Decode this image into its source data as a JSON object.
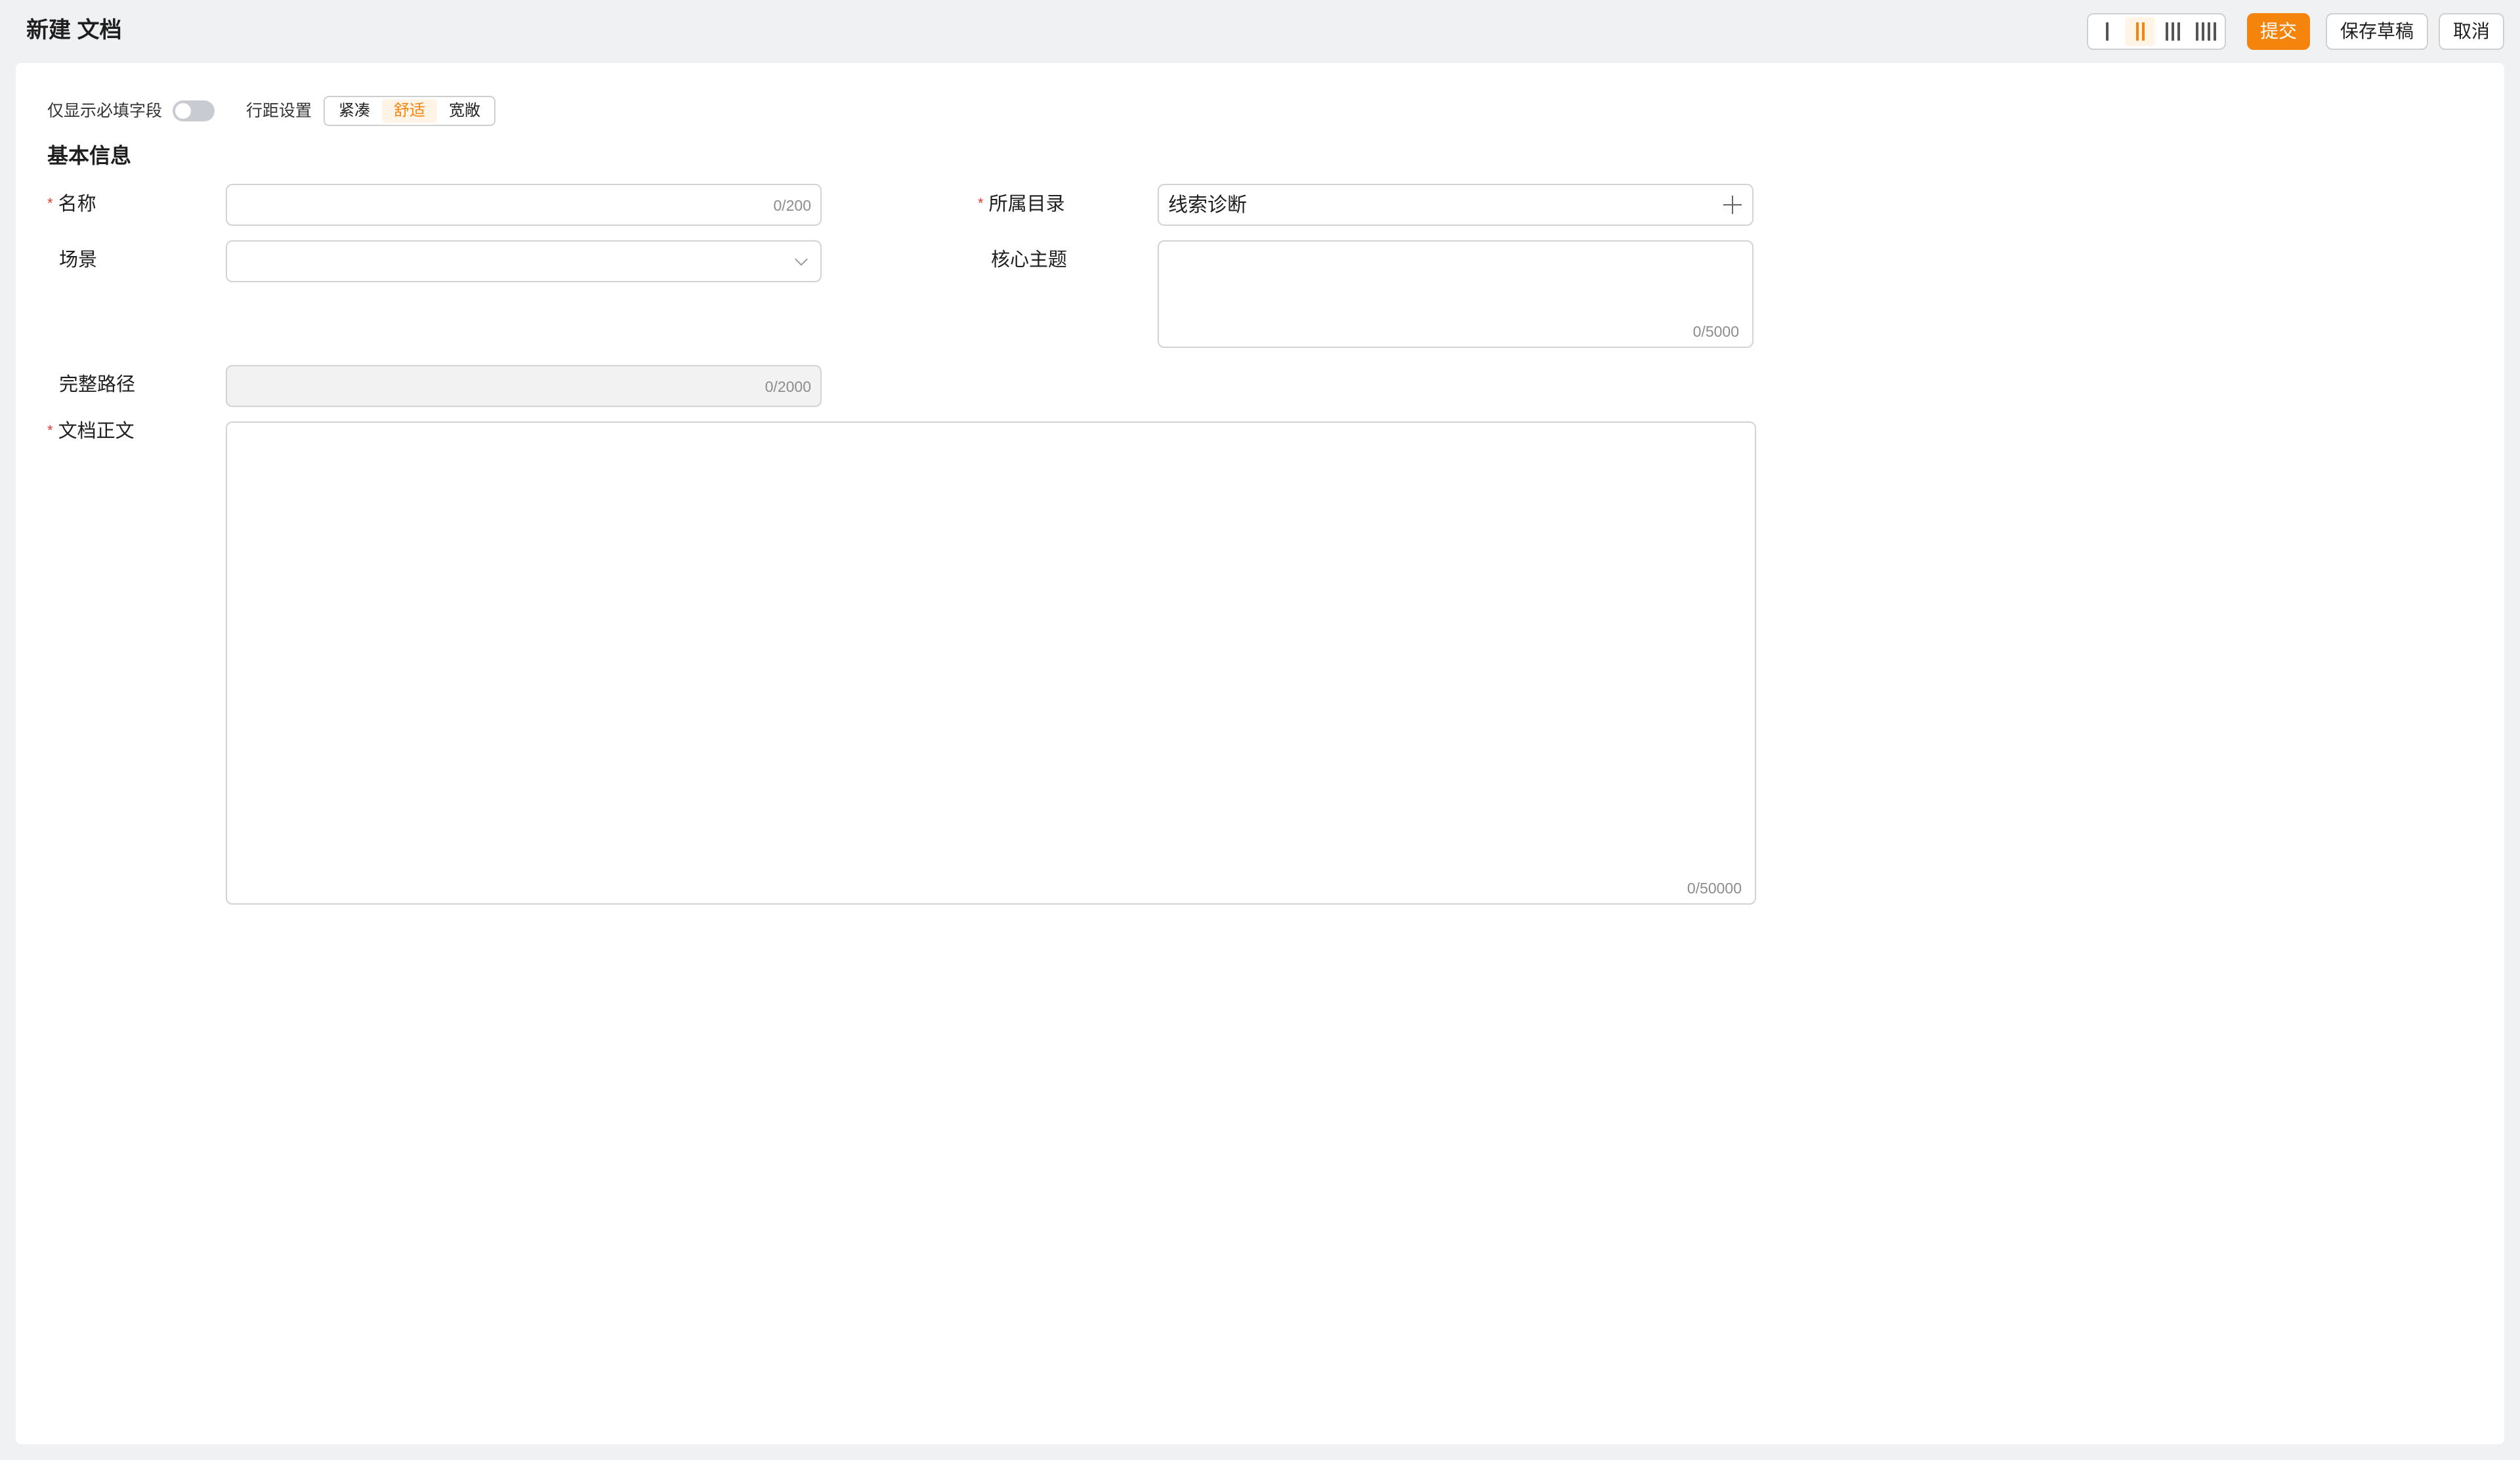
{
  "header": {
    "title": "新建 文档",
    "column_options": [
      {
        "label": "1-column",
        "bars": 1,
        "active": false
      },
      {
        "label": "2-column",
        "bars": 2,
        "active": true
      },
      {
        "label": "3-column",
        "bars": 3,
        "active": false
      },
      {
        "label": "4-column",
        "bars": 4,
        "active": false
      }
    ],
    "submit_label": "提交",
    "save_draft_label": "保存草稿",
    "cancel_label": "取消"
  },
  "toolbar": {
    "required_only_label": "仅显示必填字段",
    "required_only_on": false,
    "spacing_label": "行距设置",
    "spacing_options": [
      "紧凑",
      "舒适",
      "宽敞"
    ],
    "spacing_selected": "舒适"
  },
  "form": {
    "section_title": "基本信息",
    "name": {
      "label": "名称",
      "required": true,
      "value": "",
      "counter": "0/200"
    },
    "directory": {
      "label": "所属目录",
      "required": true,
      "value": "线索诊断"
    },
    "scene": {
      "label": "场景",
      "required": false,
      "value": ""
    },
    "core_theme": {
      "label": "核心主题",
      "required": false,
      "value": "",
      "counter": "0/5000"
    },
    "full_path": {
      "label": "完整路径",
      "required": false,
      "value": "",
      "counter": "0/2000"
    },
    "body": {
      "label": "文档正文",
      "required": true,
      "value": "",
      "counter": "0/50000"
    }
  },
  "colors": {
    "accent": "#f5840c",
    "accent_light": "#fff4e6",
    "required_mark": "#e63a2e",
    "page_bg": "#f0f1f3"
  }
}
